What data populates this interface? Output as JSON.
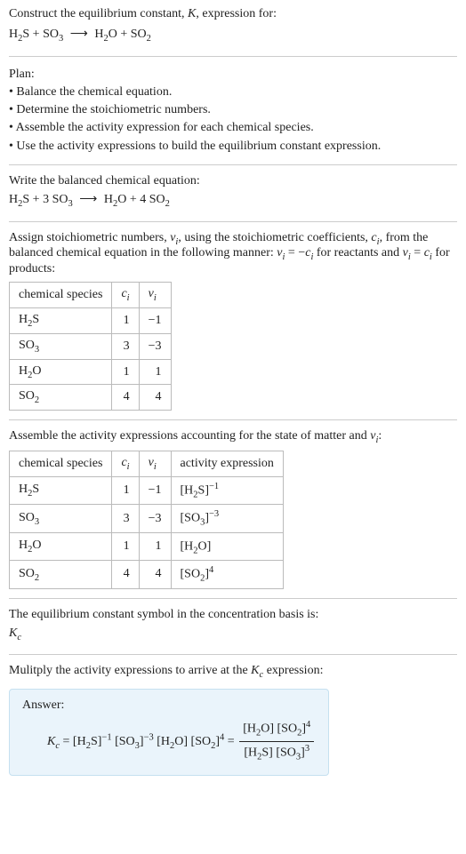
{
  "header": {
    "line1_prefix": "Construct the equilibrium constant, ",
    "line1_K": "K",
    "line1_suffix": ", expression for:"
  },
  "initial_eq": {
    "r1": "H",
    "r1_sub": "2",
    "r1_tail": "S",
    "plus1": " + ",
    "r2": "SO",
    "r2_sub": "3",
    "arrow": "⟶",
    "p1": "H",
    "p1_sub": "2",
    "p1_tail": "O",
    "plus2": " + ",
    "p2": "SO",
    "p2_sub": "2"
  },
  "plan": {
    "title": "Plan:",
    "b1": "• Balance the chemical equation.",
    "b2": "• Determine the stoichiometric numbers.",
    "b3": "• Assemble the activity expression for each chemical species.",
    "b4": "• Use the activity expressions to build the equilibrium constant expression."
  },
  "balanced": {
    "title": "Write the balanced chemical equation:",
    "r1": "H",
    "r1_sub": "2",
    "r1_tail": "S",
    "plus1": " + 3 ",
    "r2": "SO",
    "r2_sub": "3",
    "arrow": "⟶",
    "p1": "H",
    "p1_sub": "2",
    "p1_tail": "O",
    "plus2": " + 4 ",
    "p2": "SO",
    "p2_sub": "2"
  },
  "assign": {
    "part1": "Assign stoichiometric numbers, ",
    "nu_i": "ν",
    "nu_sub": "i",
    "part2": ", using the stoichiometric coefficients, ",
    "c_i": "c",
    "c_sub": "i",
    "part3": ", from the balanced chemical equation in the following manner: ",
    "eq1_l": "ν",
    "eq1_lsub": "i",
    "eq1_mid": " = −",
    "eq1_r": "c",
    "eq1_rsub": "i",
    "part4": " for reactants and ",
    "eq2_l": "ν",
    "eq2_lsub": "i",
    "eq2_mid": " = ",
    "eq2_r": "c",
    "eq2_rsub": "i",
    "part5": " for products:"
  },
  "table1": {
    "h1": "chemical species",
    "h2": "c",
    "h2_sub": "i",
    "h3": "ν",
    "h3_sub": "i",
    "rows": [
      {
        "sp": "H",
        "sp_sub": "2",
        "sp_tail": "S",
        "c": "1",
        "nu": "−1"
      },
      {
        "sp": "SO",
        "sp_sub": "3",
        "sp_tail": "",
        "c": "3",
        "nu": "−3"
      },
      {
        "sp": "H",
        "sp_sub": "2",
        "sp_tail": "O",
        "c": "1",
        "nu": "1"
      },
      {
        "sp": "SO",
        "sp_sub": "2",
        "sp_tail": "",
        "c": "4",
        "nu": "4"
      }
    ]
  },
  "assemble": {
    "part1": "Assemble the activity expressions accounting for the state of matter and ",
    "nu": "ν",
    "nu_sub": "i",
    "part2": ":"
  },
  "table2": {
    "h1": "chemical species",
    "h2": "c",
    "h2_sub": "i",
    "h3": "ν",
    "h3_sub": "i",
    "h4": "activity expression",
    "rows": [
      {
        "sp": "H",
        "sp_sub": "2",
        "sp_tail": "S",
        "c": "1",
        "nu": "−1",
        "ae": "[H",
        "ae_sub": "2",
        "ae_tail": "S]",
        "ae_exp": "−1"
      },
      {
        "sp": "SO",
        "sp_sub": "3",
        "sp_tail": "",
        "c": "3",
        "nu": "−3",
        "ae": "[SO",
        "ae_sub": "3",
        "ae_tail": "]",
        "ae_exp": "−3"
      },
      {
        "sp": "H",
        "sp_sub": "2",
        "sp_tail": "O",
        "c": "1",
        "nu": "1",
        "ae": "[H",
        "ae_sub": "2",
        "ae_tail": "O]",
        "ae_exp": ""
      },
      {
        "sp": "SO",
        "sp_sub": "2",
        "sp_tail": "",
        "c": "4",
        "nu": "4",
        "ae": "[SO",
        "ae_sub": "2",
        "ae_tail": "]",
        "ae_exp": "4"
      }
    ]
  },
  "conc": {
    "line1": "The equilibrium constant symbol in the concentration basis is:",
    "K": "K",
    "K_sub": "c"
  },
  "multiply": {
    "part1": "Mulitply the activity expressions to arrive at the ",
    "K": "K",
    "K_sub": "c",
    "part2": " expression:"
  },
  "answer": {
    "label": "Answer:",
    "K": "K",
    "K_sub": "c",
    "eq": " = ",
    "t1": "[H",
    "t1_sub": "2",
    "t1_tail": "S]",
    "t1_exp": "−1",
    "sp1": " ",
    "t2": "[SO",
    "t2_sub": "3",
    "t2_tail": "]",
    "t2_exp": "−3",
    "sp2": " ",
    "t3": "[H",
    "t3_sub": "2",
    "t3_tail": "O]",
    "sp3": " ",
    "t4": "[SO",
    "t4_sub": "2",
    "t4_tail": "]",
    "t4_exp": "4",
    "eq2": " = ",
    "num1": "[H",
    "num1_sub": "2",
    "num1_tail": "O]",
    "num_sp": " ",
    "num2": "[SO",
    "num2_sub": "2",
    "num2_tail": "]",
    "num2_exp": "4",
    "den1": "[H",
    "den1_sub": "2",
    "den1_tail": "S]",
    "den_sp": " ",
    "den2": "[SO",
    "den2_sub": "3",
    "den2_tail": "]",
    "den2_exp": "3"
  }
}
